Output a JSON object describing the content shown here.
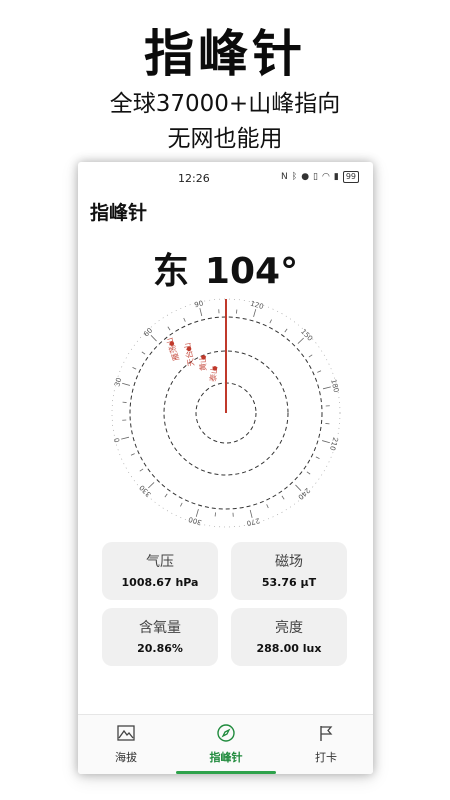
{
  "promo": {
    "title": "指峰针",
    "line1": "全球37000+山峰指向",
    "line2": "无网也能用"
  },
  "status_bar": {
    "time": "12:26",
    "icons": [
      "nfc-icon",
      "bluetooth-icon",
      "location-icon",
      "vibrate-icon",
      "wifi-icon",
      "signal-icon"
    ],
    "battery": "99"
  },
  "app": {
    "title": "指峰针"
  },
  "heading": {
    "direction": "东",
    "degrees": "104°",
    "degree_value": 104
  },
  "compass": {
    "tick_labels": [
      "30",
      "60",
      "90",
      "120",
      "150",
      "180",
      "210",
      "240",
      "270",
      "300",
      "330",
      "0"
    ],
    "peaks": [
      {
        "name": "雁荡山",
        "color": "#c0392b"
      },
      {
        "name": "天台山",
        "color": "#c0392b"
      },
      {
        "name": "黄山",
        "color": "#c0392b"
      },
      {
        "name": "泰山",
        "color": "#c0392b"
      }
    ],
    "needle_color": "#c0392b"
  },
  "sensors": [
    {
      "label": "气压",
      "value": "1008.67 hPa"
    },
    {
      "label": "磁场",
      "value": "53.76 μT"
    },
    {
      "label": "含氧量",
      "value": "20.86%"
    },
    {
      "label": "亮度",
      "value": "288.00 lux"
    }
  ],
  "nav": {
    "items": [
      {
        "label": "海拔",
        "icon": "mountain-icon"
      },
      {
        "label": "指峰针",
        "icon": "compass-icon"
      },
      {
        "label": "打卡",
        "icon": "flag-icon"
      }
    ],
    "active_index": 1,
    "accent_color": "#2ea24b"
  }
}
